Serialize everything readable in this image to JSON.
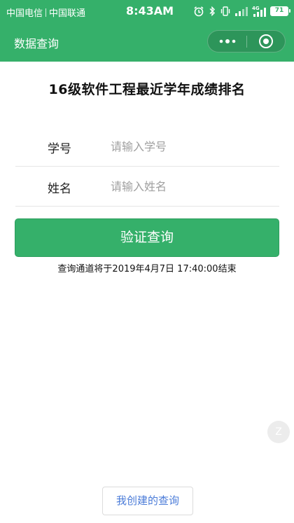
{
  "status_bar": {
    "carrier_1": "中国电信",
    "carrier_2": "中国联通",
    "time": "8:43AM",
    "network": "4G",
    "battery": "71",
    "icons": [
      "alarm-icon",
      "bluetooth-icon",
      "vibrate-icon",
      "signal-icon",
      "signal-4g-icon",
      "battery-icon"
    ]
  },
  "nav": {
    "title": "数据查询",
    "more_icon": "more-dots-icon",
    "close_icon": "target-close-icon"
  },
  "main": {
    "title": "16级软件工程最近学年成绩排名",
    "fields": [
      {
        "label": "学号",
        "placeholder": "请输入学号",
        "value": ""
      },
      {
        "label": "姓名",
        "placeholder": "请输入姓名",
        "value": ""
      }
    ],
    "verify_label": "验证查询",
    "deadline_note": "查询通道将于2019年4月7日 17:40:00结束",
    "float_label": "Z",
    "my_queries_label": "我创建的查询"
  },
  "colors": {
    "brand": "#35b06a",
    "link": "#4a7bd8",
    "placeholder": "#a0a0a0"
  }
}
